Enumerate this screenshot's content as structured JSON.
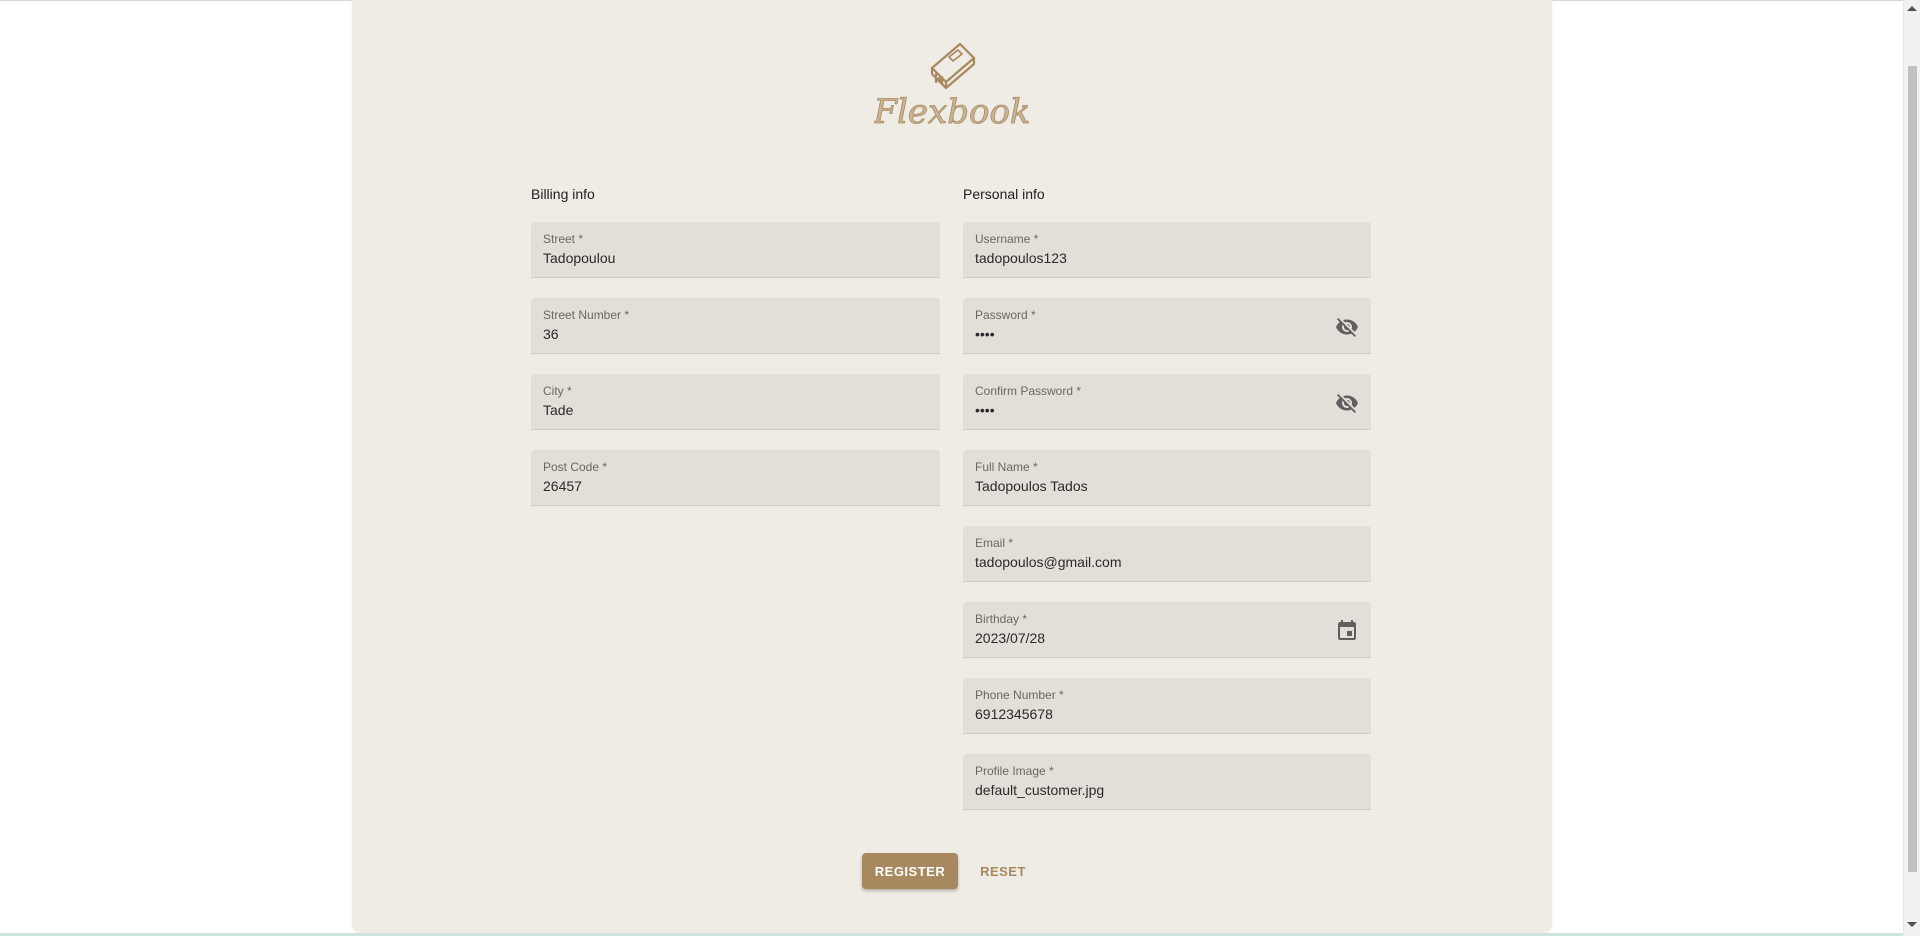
{
  "brand": {
    "name": "Flexbook",
    "color": "#a8895f"
  },
  "billing": {
    "title": "Billing info",
    "street": {
      "label": "Street *",
      "value": "Tadopoulou"
    },
    "street_number": {
      "label": "Street Number *",
      "value": "36"
    },
    "city": {
      "label": "City *",
      "value": "Tade"
    },
    "post_code": {
      "label": "Post Code *",
      "value": "26457"
    }
  },
  "personal": {
    "title": "Personal info",
    "username": {
      "label": "Username *",
      "value": "tadopoulos123"
    },
    "password": {
      "label": "Password *",
      "value": "••••",
      "icon": "eye-off-icon"
    },
    "confirm_password": {
      "label": "Confirm Password *",
      "value": "••••",
      "icon": "eye-off-icon"
    },
    "full_name": {
      "label": "Full Name *",
      "value": "Tadopoulos Tados"
    },
    "email": {
      "label": "Email *",
      "value": "tadopoulos@gmail.com"
    },
    "birthday": {
      "label": "Birthday *",
      "value": "2023/07/28",
      "icon": "calendar-icon"
    },
    "phone": {
      "label": "Phone Number *",
      "value": "6912345678"
    },
    "profile_image": {
      "label": "Profile Image *",
      "value": "default_customer.jpg"
    }
  },
  "actions": {
    "register_label": "REGISTER",
    "reset_label": "RESET"
  }
}
